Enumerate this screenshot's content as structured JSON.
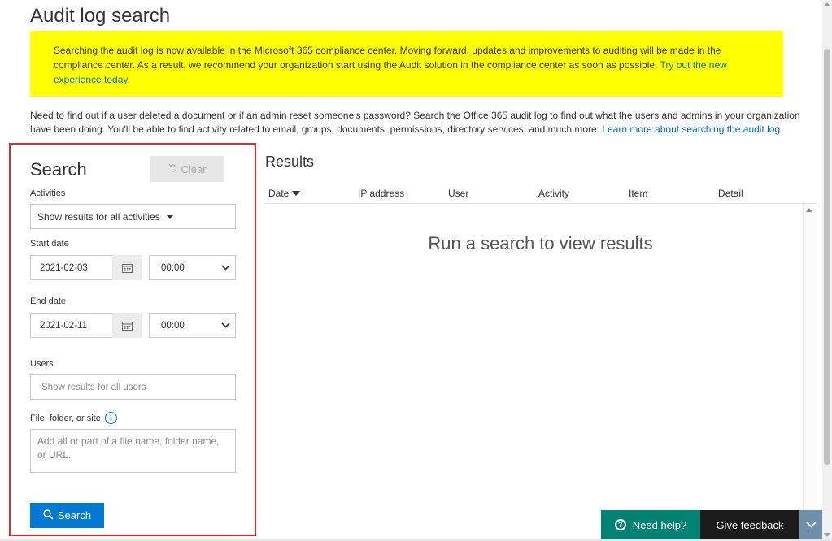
{
  "page": {
    "title": "Audit log search"
  },
  "banner": {
    "text": "Searching the audit log is now available in the Microsoft 365 compliance center. Moving forward, updates and improvements to auditing will be made in the compliance center. As a result, we recommend your organization start using the Audit solution in the compliance center as soon as possible. ",
    "link": "Try out the new experience today.",
    "color": "#ffff00"
  },
  "intro": {
    "text": "Need to find out if a user deleted a document or if an admin reset someone's password? Search the Office 365 audit log to find out what the users and admins in your organization have been doing. You'll be able to find activity related to email, groups, documents, permissions, directory services, and much more. ",
    "link": "Learn more about searching the audit log"
  },
  "search": {
    "heading": "Search",
    "clear_label": "Clear",
    "activities_label": "Activities",
    "activities_value": "Show results for all activities",
    "start_date_label": "Start date",
    "start_date": "2021-02-03",
    "start_time": "00:00",
    "end_date_label": "End date",
    "end_date": "2021-02-11",
    "end_time": "00:00",
    "users_label": "Users",
    "users_placeholder": "Show results for all users",
    "file_label": "File, folder, or site",
    "file_placeholder": "Add all or part of a file name, folder name, or URL.",
    "search_button": "Search"
  },
  "results": {
    "heading": "Results",
    "columns": [
      "Date",
      "IP address",
      "User",
      "Activity",
      "Item",
      "Detail"
    ],
    "empty_message": "Run a search to view results"
  },
  "footer": {
    "need_help": "Need help?",
    "give_feedback": "Give feedback"
  },
  "colors": {
    "accent": "#0078d4",
    "highlight_border": "#e0282e",
    "help_button": "#008272"
  },
  "icons": [
    "undo-icon",
    "calendar-icon",
    "chevron-down-icon",
    "info-icon",
    "search-icon",
    "help-icon",
    "sort-down-icon"
  ]
}
